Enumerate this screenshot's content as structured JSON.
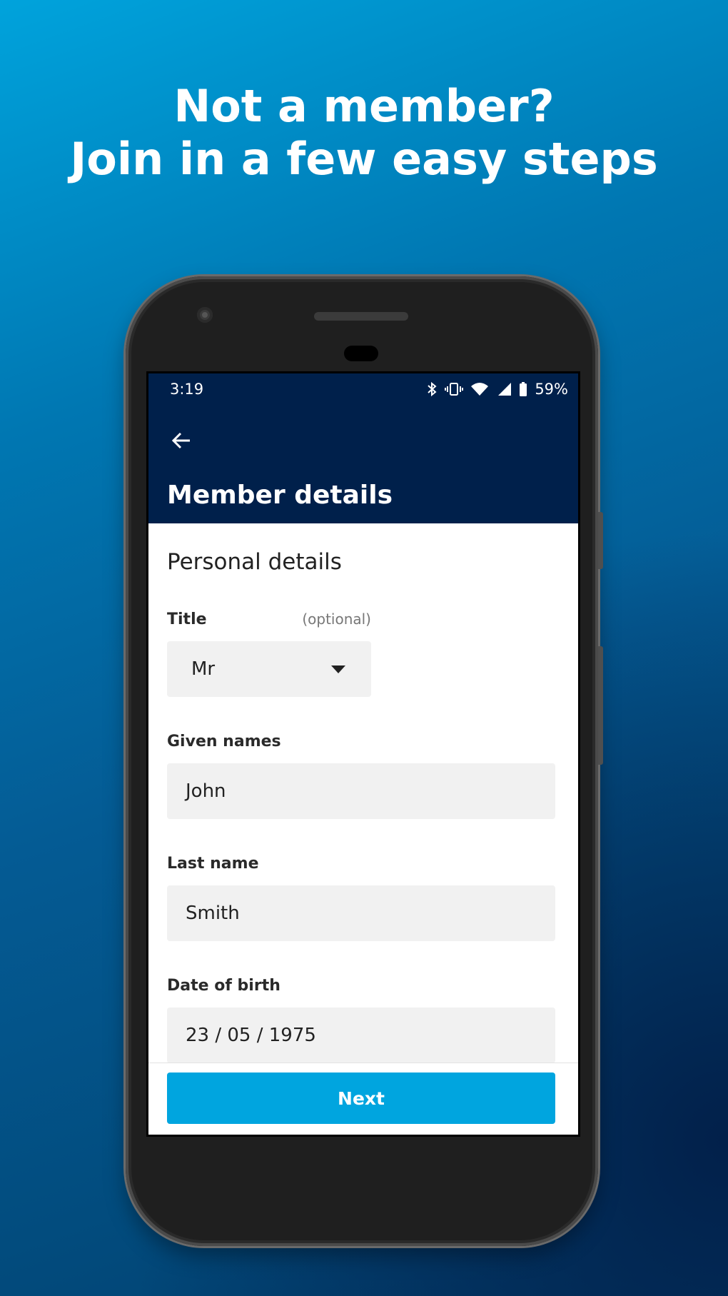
{
  "promo": {
    "headline_line1": "Not a member?",
    "headline_line2": "Join in a few easy steps"
  },
  "status_bar": {
    "time": "3:19",
    "battery": "59%",
    "icons": [
      "bluetooth-icon",
      "vibrate-icon",
      "wifi-icon",
      "cell-signal-icon",
      "battery-icon"
    ]
  },
  "app_bar": {
    "back_icon": "arrow-left-icon",
    "title": "Member details"
  },
  "form": {
    "section_title": "Personal details",
    "title_field": {
      "label": "Title",
      "hint": "(optional)",
      "value": "Mr"
    },
    "given_names": {
      "label": "Given names",
      "value": "John"
    },
    "last_name": {
      "label": "Last name",
      "value": "Smith"
    },
    "date_of_birth": {
      "label": "Date of birth",
      "value": "23 / 05 / 1975"
    }
  },
  "actions": {
    "next_label": "Next"
  },
  "colors": {
    "brand_navy": "#00204b",
    "accent_blue": "#00a5df",
    "input_bg": "#f1f1f1"
  }
}
